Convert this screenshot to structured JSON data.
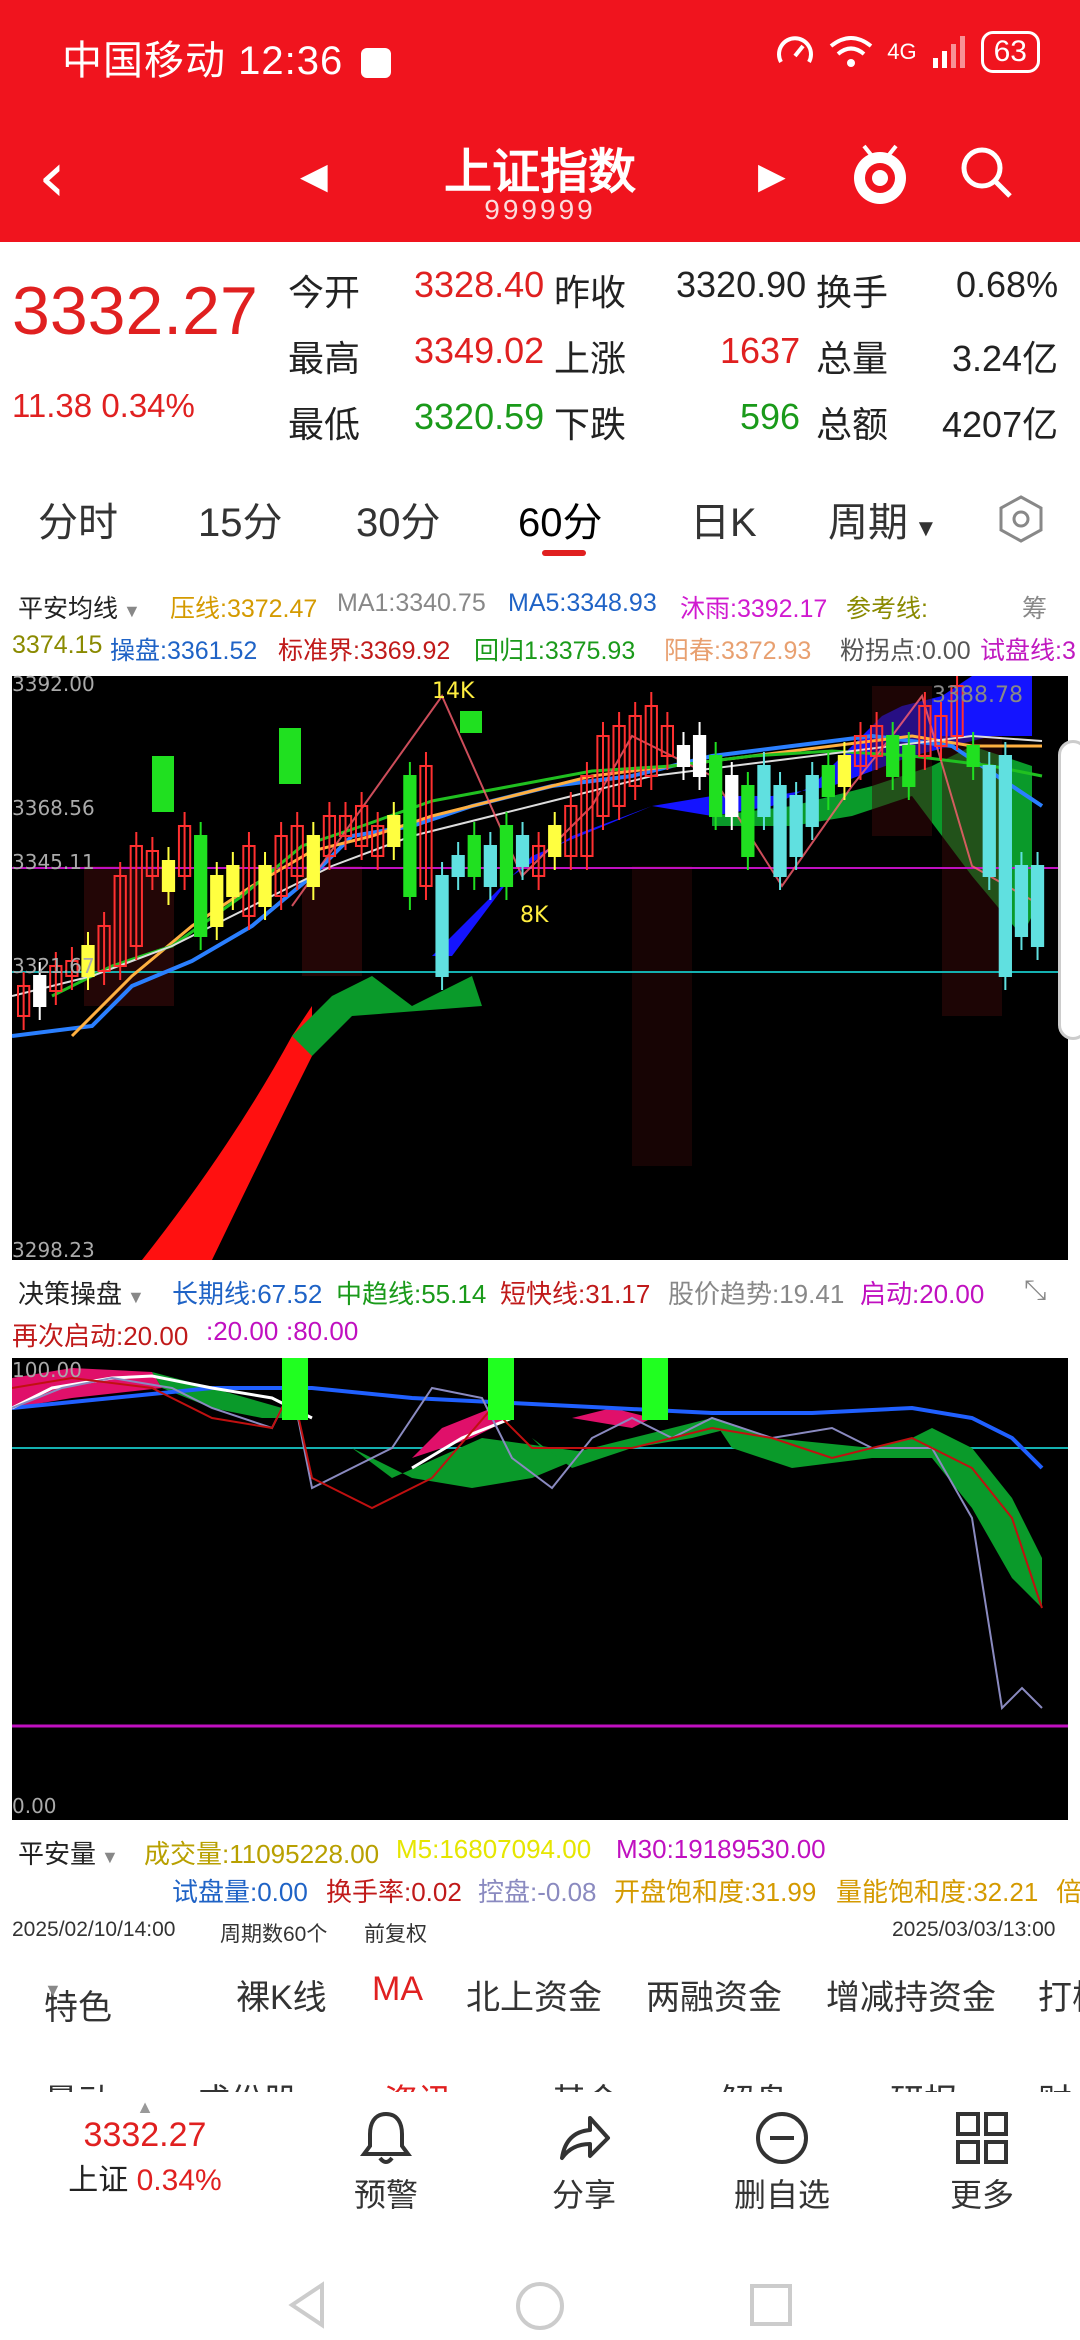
{
  "status_bar": {
    "carrier": "中国移动",
    "time": "12:36",
    "network": "4G",
    "battery": "63"
  },
  "header": {
    "title": "上证指数",
    "code": "999999"
  },
  "quote": {
    "price": "3332.27",
    "change": "11.38",
    "change_pct": "0.34%",
    "open_label": "今开",
    "open": "3328.40",
    "prev_label": "昨收",
    "prev": "3320.90",
    "turnover_label": "换手",
    "turnover": "0.68%",
    "high_label": "最高",
    "high": "3349.02",
    "up_label": "上涨",
    "up": "1637",
    "volume_label": "总量",
    "volume": "3.24亿",
    "low_label": "最低",
    "low": "3320.59",
    "down_label": "下跌",
    "down": "596",
    "amount_label": "总额",
    "amount": "4207亿"
  },
  "tabs": [
    "分时",
    "15分",
    "30分",
    "60分",
    "日K",
    "周期"
  ],
  "active_tab": "60分",
  "indicator_main": {
    "name": "平安均线",
    "row1": [
      "压线:3372.47",
      "MA1:3340.75",
      "MA5:3348.93",
      "沐雨:3392.17",
      "参考线:"
    ],
    "row1_right": "筹",
    "row2": [
      "3374.15",
      "操盘:3361.52",
      "标准界:3369.92",
      "回归1:3375.93",
      "阳春:3372.93",
      "粉拐点:0.00",
      "试盘线:3"
    ],
    "y_ticks": [
      "3392.00",
      "3368.56",
      "3345.11",
      "3321.67",
      "3298.23"
    ],
    "annotations": [
      "14K",
      "8K",
      "3388.78"
    ]
  },
  "indicator_mid": {
    "name": "决策操盘",
    "row1": [
      "长期线:67.52",
      "中趋线:55.14",
      "短快线:31.17",
      "股价趋势:19.41",
      "启动:20.00"
    ],
    "row2": [
      "再次启动:20.00",
      ":20.00",
      ":80.00"
    ],
    "y_ticks": [
      "100.00",
      "0.00"
    ]
  },
  "indicator_vol": {
    "name": "平安量",
    "row1": [
      "成交量:11095228.00",
      "M5:16807094.00",
      "M30:19189530.00"
    ],
    "row2": [
      "试盘量:0.00",
      "换手率:0.02",
      "控盘:-0.08",
      "开盘饱和度:31.99",
      "量能饱和度:32.21",
      "倍"
    ]
  },
  "footer_info": {
    "start": "2025/02/10/14:00",
    "period_count": "周期数60个",
    "adjust": "前复权",
    "end": "2025/03/03/13:00"
  },
  "sub_tabs": [
    "特色",
    "裸K线",
    "MA",
    "北上资金",
    "两融资金",
    "增减持资金",
    "打板"
  ],
  "cut_row": [
    "量动",
    "成份股",
    "资讯",
    "基金",
    "解盘",
    "研报",
    "财"
  ],
  "bottom_bar": {
    "price": "3332.27",
    "name": "上证",
    "pct": "0.34%",
    "items": [
      "预警",
      "分享",
      "删自选",
      "更多"
    ]
  },
  "colors": {
    "brand_red": "#f0141e",
    "up_red": "#e02020",
    "down_green": "#1a9a1a"
  }
}
